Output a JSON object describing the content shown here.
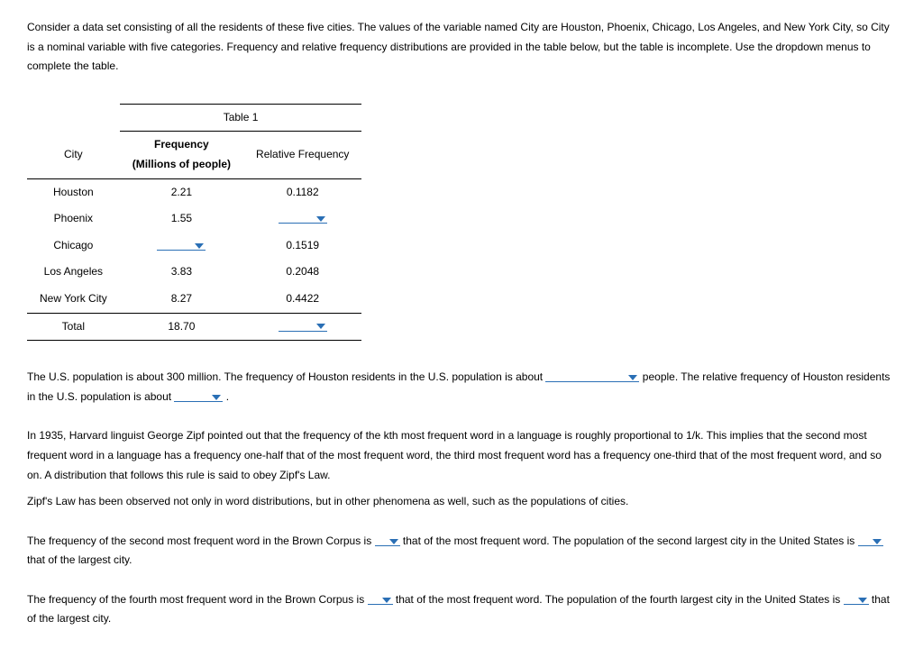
{
  "intro": "Consider a data set consisting of all the residents of these five cities. The values of the variable named City are Houston, Phoenix, Chicago, Los Angeles, and New York City, so City is a nominal variable with five categories. Frequency and relative frequency distributions are provided in the table below, but the table is incomplete. Use the dropdown menus to complete the table.",
  "table": {
    "title": "Table 1",
    "headers": {
      "city": "City",
      "freq_top": "Frequency",
      "freq_sub": "(Millions of people)",
      "relfreq": "Relative Frequency"
    },
    "rows": [
      {
        "city": "Houston",
        "freq": "2.21",
        "relfreq": "0.1182",
        "freq_dd": false,
        "relfreq_dd": false
      },
      {
        "city": "Phoenix",
        "freq": "1.55",
        "relfreq": "",
        "freq_dd": false,
        "relfreq_dd": true
      },
      {
        "city": "Chicago",
        "freq": "",
        "relfreq": "0.1519",
        "freq_dd": true,
        "relfreq_dd": false
      },
      {
        "city": "Los Angeles",
        "freq": "3.83",
        "relfreq": "0.2048",
        "freq_dd": false,
        "relfreq_dd": false
      },
      {
        "city": "New York City",
        "freq": "8.27",
        "relfreq": "0.4422",
        "freq_dd": false,
        "relfreq_dd": false
      }
    ],
    "total": {
      "label": "Total",
      "freq": "18.70",
      "relfreq_dd": true
    }
  },
  "p1": {
    "a": "The U.S. population is about 300 million. The frequency of Houston residents in the U.S. population is about ",
    "b": " people. The relative frequency of Houston residents in the U.S. population is about ",
    "c": " ."
  },
  "p2": "In 1935, Harvard linguist George Zipf pointed out that the frequency of the kth most frequent word in a language is roughly proportional to 1/k. This implies that the second most frequent word in a language has a frequency one-half that of the most frequent word, the third most frequent word has a frequency one-third that of the most frequent word, and so on. A distribution that follows this rule is said to obey Zipf's Law.",
  "p3": "Zipf's Law has been observed not only in word distributions, but in other phenomena as well, such as the populations of cities.",
  "p4": {
    "a": "The frequency of the second most frequent word in the Brown Corpus is ",
    "b": " that of the most frequent word. The population of the second largest city in the United States is ",
    "c": " that of the largest city."
  },
  "p5": {
    "a": "The frequency of the fourth most frequent word in the Brown Corpus is ",
    "b": " that of the most frequent word. The population of the fourth largest city in the United States is ",
    "c": " that of the largest city."
  }
}
